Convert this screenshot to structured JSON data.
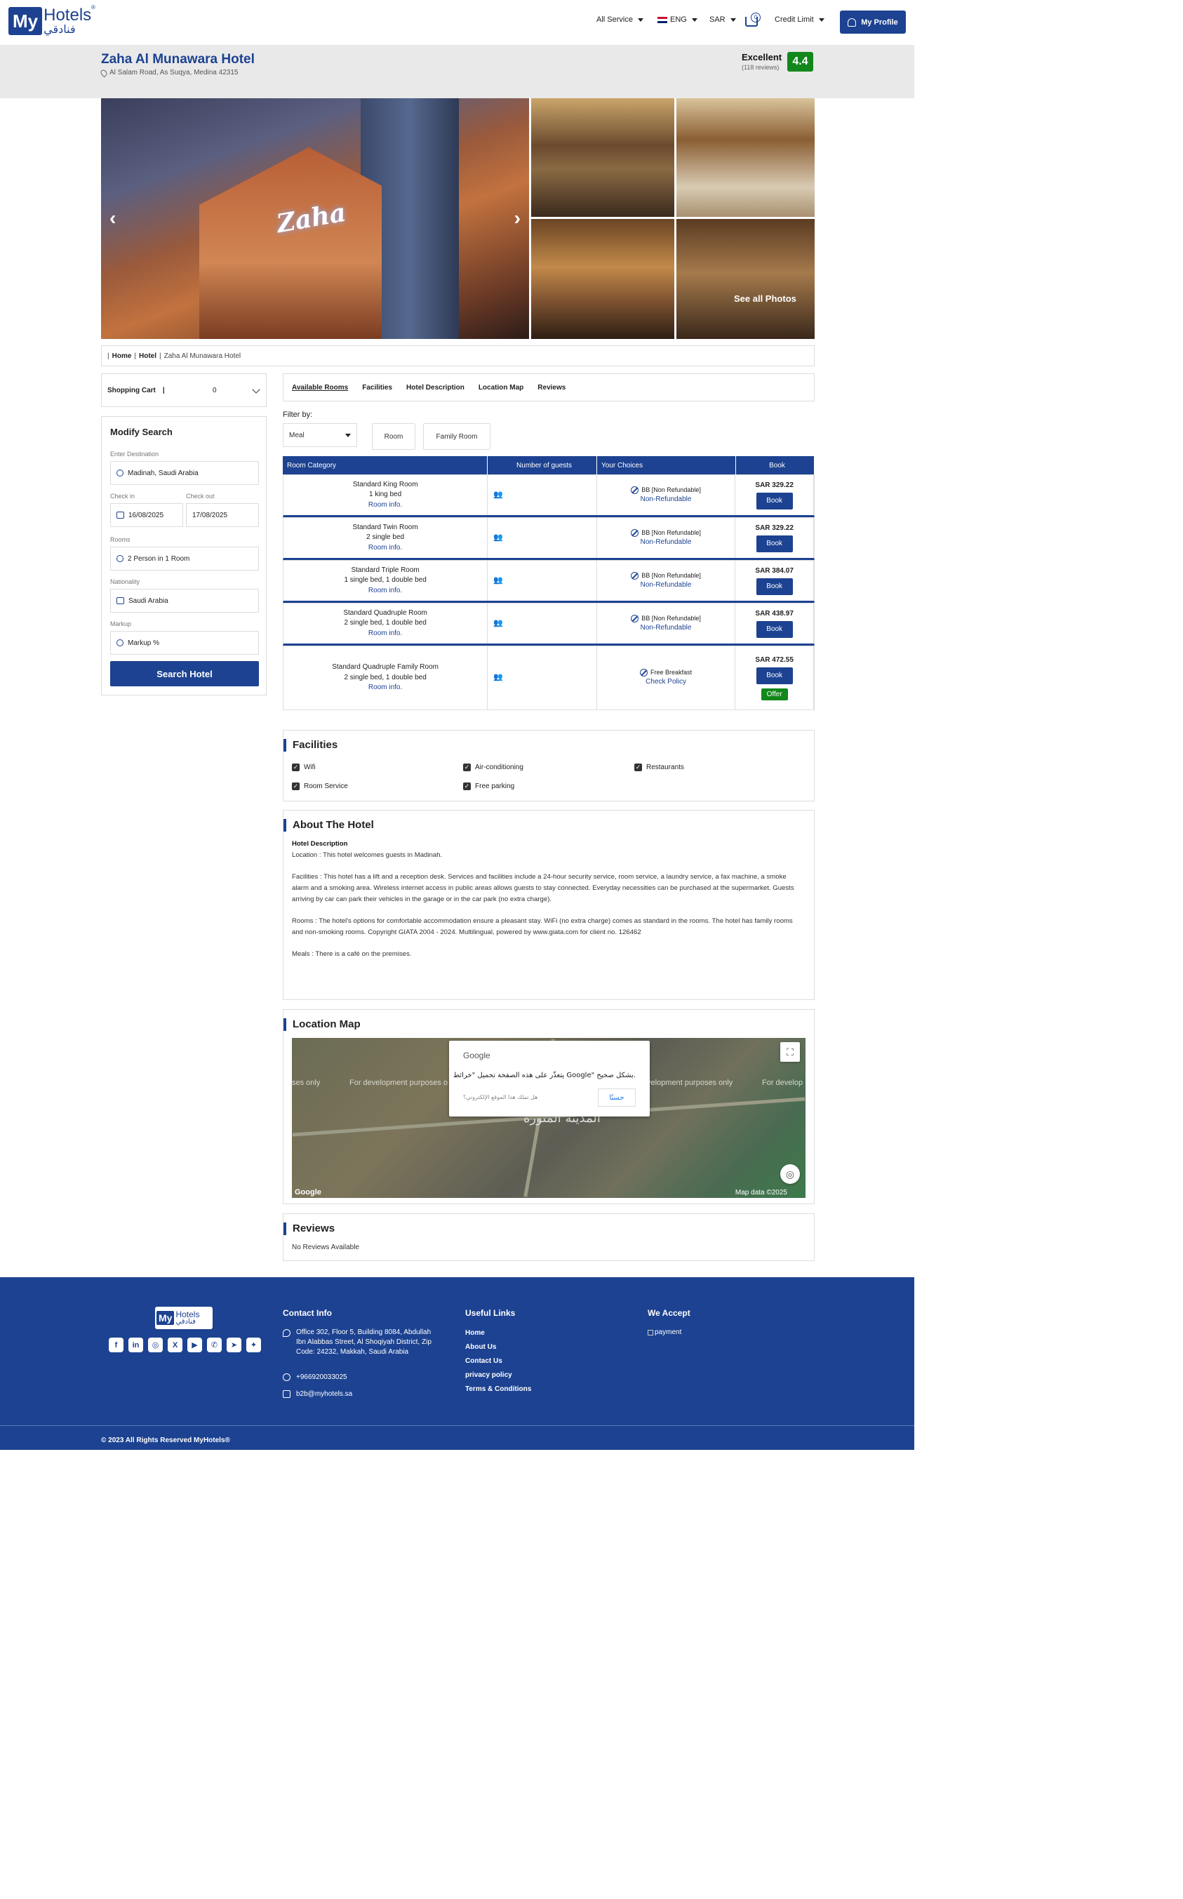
{
  "header": {
    "logo_my": "My",
    "logo_hotels": "Hotels",
    "logo_arabic": "فنادقي",
    "logo_reg": "®",
    "nav": {
      "all_service": "All Service",
      "language": "ENG",
      "currency": "SAR",
      "cart_count": "0",
      "credit_limit": "Credit Limit",
      "profile": "My Profile"
    }
  },
  "hotel": {
    "name": "Zaha Al Munawara Hotel",
    "address": "Al Salam Road, As Suqya, Medina 42315",
    "rating_word": "Excellent",
    "rating_count": "(118 reviews)",
    "rating_score": "4.4",
    "main_photo_sign": "Zaha",
    "see_all_photos": "See all Photos"
  },
  "breadcrumb": {
    "sep1": "|",
    "home": "Home",
    "sep2": "|",
    "hotel": "Hotel",
    "sep3": "|",
    "current": "Zaha Al Munawara Hotel"
  },
  "sidebar": {
    "shopping_cart": "Shopping Cart",
    "shopping_cart_sep": "|",
    "shopping_cart_count": "0",
    "modify_title": "Modify Search",
    "destination_label": "Enter Destination",
    "destination_value": "Madinah, Saudi Arabia",
    "checkin_label": "Check in",
    "checkin_value": "16/08/2025",
    "checkout_label": "Check out",
    "checkout_value": "17/08/2025",
    "rooms_label": "Rooms",
    "rooms_value": "2 Person in 1 Room",
    "nationality_label": "Nationality",
    "nationality_value": "Saudi Arabia",
    "markup_label": "Markup",
    "markup_value": "Markup %",
    "search_button": "Search Hotel"
  },
  "tabs": [
    "Available Rooms",
    "Facilities",
    "Hotel Description",
    "Location Map",
    "Reviews"
  ],
  "filter": {
    "label": "Filter by:",
    "meal": "Meal",
    "room": "Room",
    "family_room": "Family Room"
  },
  "rooms_table": {
    "headers": [
      "Room Category",
      "Number of guests",
      "Your Choices",
      "Book"
    ],
    "rows": [
      {
        "name": "Standard King Room",
        "beds": "1 king bed",
        "info": "Room info.",
        "guests_icon": "👥",
        "choice": "BB [Non Refundable]",
        "policy": "Non-Refundable",
        "price": "SAR 329.22",
        "book": "Book",
        "offer": ""
      },
      {
        "name": "Standard Twin Room",
        "beds": "2 single bed",
        "info": "Room info.",
        "guests_icon": "👥",
        "choice": "BB [Non Refundable]",
        "policy": "Non-Refundable",
        "price": "SAR 329.22",
        "book": "Book",
        "offer": ""
      },
      {
        "name": "Standard Triple Room",
        "beds": "1 single bed, 1 double bed",
        "info": "Room info.",
        "guests_icon": "👥",
        "choice": "BB [Non Refundable]",
        "policy": "Non-Refundable",
        "price": "SAR 384.07",
        "book": "Book",
        "offer": ""
      },
      {
        "name": "Standard Quadruple Room",
        "beds": "2 single bed, 1 double bed",
        "info": "Room info.",
        "guests_icon": "👥",
        "choice": "BB [Non Refundable]",
        "policy": "Non-Refundable",
        "price": "SAR 438.97",
        "book": "Book",
        "offer": ""
      },
      {
        "name": "Standard Quadruple Family Room",
        "beds": "2 single bed, 1 double bed",
        "info": "Room info.",
        "guests_icon": "👥",
        "choice": "Free Breakfast",
        "policy": "Check Policy",
        "price": "SAR 472.55",
        "book": "Book",
        "offer": "Offer"
      }
    ]
  },
  "facilities": {
    "title": "Facilities",
    "items": [
      "Wifi",
      "Air-conditioning",
      "Restaurants",
      "Room Service",
      "Free parking"
    ]
  },
  "about": {
    "title": "About The Hotel",
    "subtitle": "Hotel Description",
    "location": "Location : This hotel welcomes guests in Madinah.",
    "facilities": "Facilities : This hotel has a lift and a reception desk. Services and facilities include a 24-hour security service, room service, a laundry service, a fax machine, a smoke alarm and a smoking area. Wireless internet access in public areas allows guests to stay connected. Everyday necessities can be purchased at the supermarket. Guests arriving by car can park their vehicles in the garage or in the car park (no extra charge).",
    "rooms": "Rooms : The hotel's options for comfortable accommodation ensure a pleasant stay. WiFi (no extra charge) comes as standard in the rooms. The hotel has family rooms and non-smoking rooms. Copyright GIATA 2004 - 2024. Multilingual, powered by www.giata.com for client no. 126462",
    "meals": "Meals : There is a café on the premises."
  },
  "location_map": {
    "title": "Location Map",
    "google_label": "Google",
    "popup_message": "يتعذّر على هذه الصفحة تحميل \"خرائط Google\" بشكل صحيح.",
    "popup_owner": "هل تملك هذا الموقع الإلكتروني؟",
    "popup_ok": "حسنًا",
    "watermark_left": "ses only",
    "watermark_mid": "For development purposes o",
    "watermark_right": "velopment purposes only",
    "watermark_far": "For develop",
    "city_label": "المدينة المنورة",
    "map_logo": "Google",
    "map_data": "Map data ©2025",
    "fullscreen_icon": "⛶",
    "locate_icon": "◎"
  },
  "reviews": {
    "title": "Reviews",
    "empty": "No Reviews Available"
  },
  "footer": {
    "logo_my": "My",
    "logo_hotels": "Hotels",
    "logo_arabic": "فنادقي",
    "socials": [
      "f",
      "in",
      "◎",
      "X",
      "▶",
      "✆",
      "➤",
      "✦"
    ],
    "contact_title": "Contact Info",
    "address": "Office 302, Floor 5, Building 8084, Abdullah Ibn Alabbas Street, Al Shoqiyah District, Zip Code: 24232, Makkah, Saudi Arabia",
    "phone": "+966920033025",
    "email": "b2b@myhotels.sa",
    "links_title": "Useful Links",
    "links": [
      "Home",
      "About Us",
      "Contact Us",
      "privacy policy",
      "Terms & Conditions"
    ],
    "accept_title": "We Accept",
    "payment_alt": "payment",
    "copyright": "© 2023 All Rights Reserved MyHotels®"
  },
  "colors": {
    "brand": "#1c4291",
    "rating": "#12871b"
  }
}
